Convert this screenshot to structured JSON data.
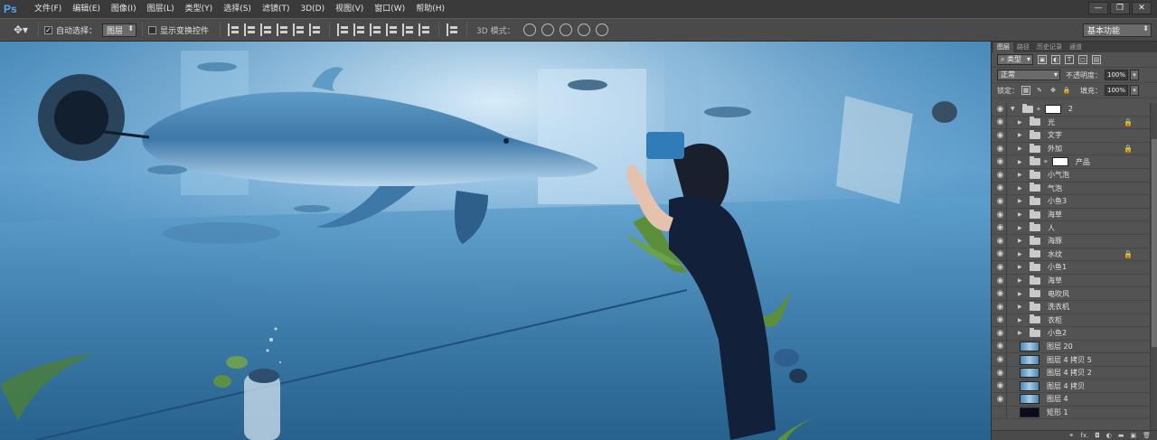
{
  "app": {
    "logo": "Ps"
  },
  "menu": [
    "文件(F)",
    "编辑(E)",
    "图像(I)",
    "图层(L)",
    "类型(Y)",
    "选择(S)",
    "滤镜(T)",
    "3D(D)",
    "视图(V)",
    "窗口(W)",
    "帮助(H)"
  ],
  "window_controls": [
    "—",
    "❐",
    "✕"
  ],
  "options": {
    "auto_select_label": "自动选择：",
    "auto_select_checked": true,
    "auto_select_value": "图层",
    "show_transform_label": "显示变换控件",
    "show_transform_checked": false,
    "mode_3d_label": "3D 模式：",
    "workspace": "基本功能"
  },
  "panel": {
    "tabs": [
      "图层",
      "路径",
      "历史记录",
      "通道"
    ],
    "filter_kind": "类型",
    "blend_mode": "正常",
    "opacity_label": "不透明度：",
    "opacity_value": "100%",
    "lock_label": "锁定：",
    "fill_label": "填充：",
    "fill_value": "100%"
  },
  "layers": [
    {
      "name": "2",
      "type": "group-open",
      "mask": true,
      "locked": false,
      "visible": true
    },
    {
      "name": "光",
      "type": "group",
      "locked": true,
      "visible": true
    },
    {
      "name": "文字",
      "type": "group",
      "locked": false,
      "visible": true
    },
    {
      "name": "外加",
      "type": "group",
      "locked": true,
      "visible": true
    },
    {
      "name": "产品",
      "type": "group",
      "mask": true,
      "locked": false,
      "visible": true
    },
    {
      "name": "小气泡",
      "type": "group",
      "locked": false,
      "visible": true
    },
    {
      "name": "气泡",
      "type": "group",
      "locked": false,
      "visible": true
    },
    {
      "name": "小鱼3",
      "type": "group",
      "locked": false,
      "visible": true
    },
    {
      "name": "海草",
      "type": "group",
      "locked": false,
      "visible": true
    },
    {
      "name": "人",
      "type": "group",
      "locked": false,
      "visible": true
    },
    {
      "name": "海豚",
      "type": "group",
      "locked": false,
      "visible": true
    },
    {
      "name": "水纹",
      "type": "group",
      "locked": true,
      "visible": true
    },
    {
      "name": "小鱼1",
      "type": "group",
      "locked": false,
      "visible": true
    },
    {
      "name": "海草",
      "type": "group",
      "locked": false,
      "visible": true
    },
    {
      "name": "电吹风",
      "type": "group",
      "locked": false,
      "visible": true
    },
    {
      "name": "洗衣机",
      "type": "group",
      "locked": false,
      "visible": true
    },
    {
      "name": "衣柜",
      "type": "group",
      "locked": false,
      "visible": true
    },
    {
      "name": "小鱼2",
      "type": "group",
      "locked": false,
      "visible": true
    },
    {
      "name": "图层 20",
      "type": "image",
      "locked": false,
      "visible": true
    },
    {
      "name": "图层 4 拷贝 5",
      "type": "image",
      "locked": false,
      "visible": true
    },
    {
      "name": "图层 4 拷贝 2",
      "type": "image",
      "locked": false,
      "visible": true
    },
    {
      "name": "图层 4 拷贝",
      "type": "image",
      "locked": false,
      "visible": true
    },
    {
      "name": "图层 4",
      "type": "image",
      "locked": false,
      "visible": true
    },
    {
      "name": "矩形 1",
      "type": "shape",
      "locked": false,
      "visible": false
    }
  ],
  "footer_icons": [
    "link-icon",
    "fx-icon",
    "mask-icon",
    "adjustment-icon",
    "folder-icon",
    "new-layer-icon",
    "trash-icon"
  ],
  "footer_glyphs": [
    "⚭",
    "fx.",
    "◘",
    "◐",
    "▬",
    "▣",
    "🗑"
  ]
}
